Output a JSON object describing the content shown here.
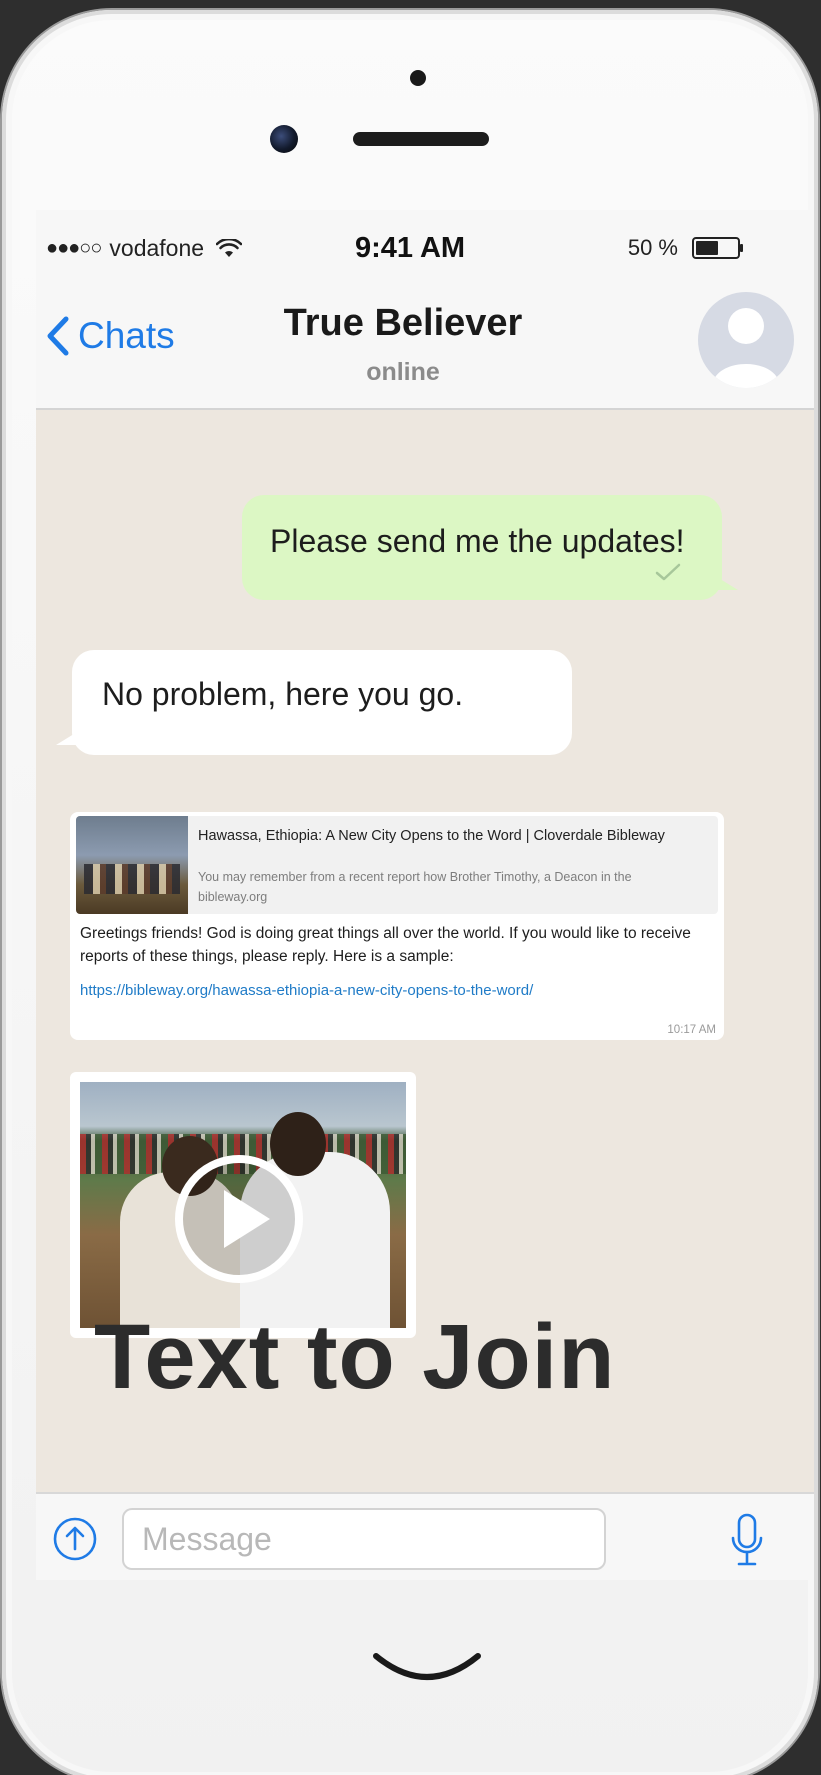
{
  "status_bar": {
    "signal_dots": "●●●○○",
    "carrier": "vodafone",
    "time": "9:41 AM",
    "battery_percent": "50 %"
  },
  "nav": {
    "back_label": "Chats",
    "contact_name": "True Believer",
    "contact_status": "online"
  },
  "messages": {
    "outgoing": "Please send me the updates!",
    "incoming": "No problem, here you go."
  },
  "link_card": {
    "preview_title": "Hawassa, Ethiopia: A New City Opens to the Word | Cloverdale Bibleway",
    "preview_desc": "You may remember from a recent report how Brother Timothy, a Deacon in the",
    "preview_domain": "bibleway.org",
    "body": "Greetings friends! God is doing great things all over the world. If you would like to receive reports of these things, please reply.  Here is a sample:",
    "link": "https://bibleway.org/hawassa-ethiopia-a-new-city-opens-to-the-word/",
    "time": "10:17 AM"
  },
  "overlay_text": "Text to Join",
  "input": {
    "placeholder": "Message"
  },
  "colors": {
    "ios_blue": "#1f7be6",
    "outgoing_bubble": "#dcf7c4",
    "chat_background": "#ede7df"
  },
  "icons": {
    "wifi": "wifi-icon",
    "battery": "battery-icon",
    "back": "chevron-left-icon",
    "avatar": "avatar-placeholder-icon",
    "read_receipt": "check-icon",
    "play": "play-icon",
    "upload": "upload-arrow-icon",
    "mic": "microphone-icon"
  }
}
